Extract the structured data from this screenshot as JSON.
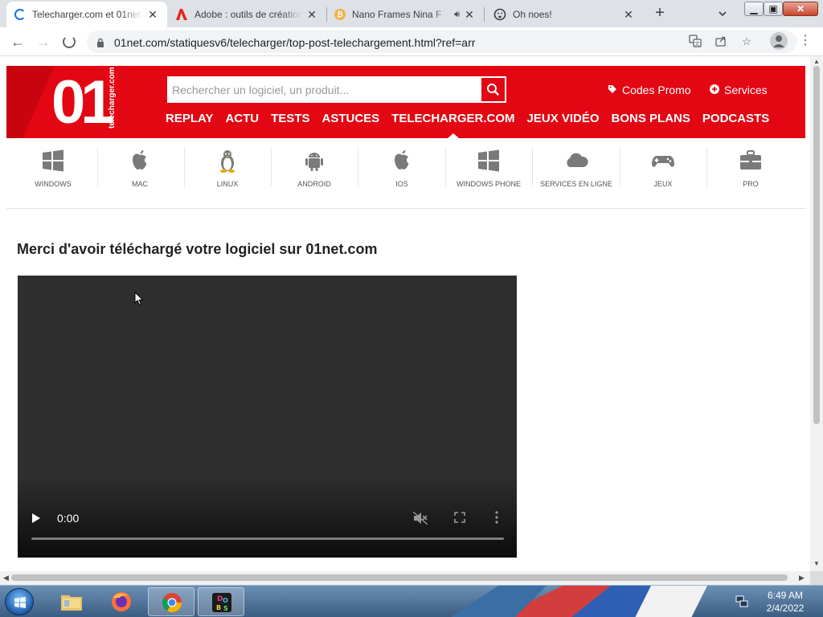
{
  "browser": {
    "tabs": [
      {
        "title": "Telecharger.com et 01net",
        "active": true,
        "favicon": "loading-spinner-icon"
      },
      {
        "title": "Adobe : outils de création",
        "active": false,
        "favicon": "adobe-icon"
      },
      {
        "title": "Nano Frames Nina F",
        "active": false,
        "favicon": "nano-icon",
        "audio": true
      },
      {
        "title": "Oh noes!",
        "active": false,
        "favicon": "oh-noes-icon"
      }
    ],
    "close_symbol": "✕",
    "new_tab_symbol": "+",
    "url": "01net.com/statiquesv6/telecharger/top-post-telechargement.html?ref=arr",
    "window_buttons": {
      "minimize": "▁",
      "maximize": "▣",
      "close": "✕"
    },
    "accent": "#1a73e8"
  },
  "site": {
    "brand_color": "#e30613",
    "logo": {
      "mark": "01",
      "sub": "telecharger.com"
    },
    "search": {
      "placeholder": "Rechercher un logiciel, un produit..."
    },
    "header_links": [
      {
        "label": "Codes Promo",
        "icon": "tag-icon"
      },
      {
        "label": "Services",
        "icon": "plus-circle-icon"
      }
    ],
    "nav": [
      "REPLAY",
      "ACTU",
      "TESTS",
      "ASTUCES",
      "TELECHARGER.COM",
      "JEUX VIDÉO",
      "BONS PLANS",
      "PODCASTS"
    ],
    "active_nav": "TELECHARGER.COM",
    "platforms": [
      {
        "label": "WINDOWS",
        "icon": "windows-icon"
      },
      {
        "label": "MAC",
        "icon": "apple-icon"
      },
      {
        "label": "LINUX",
        "icon": "linux-icon"
      },
      {
        "label": "ANDROID",
        "icon": "android-icon"
      },
      {
        "label": "IOS",
        "icon": "apple-icon"
      },
      {
        "label": "WINDOWS PHONE",
        "icon": "windows-icon"
      },
      {
        "label": "SERVICES EN LIGNE",
        "icon": "cloud-icon"
      },
      {
        "label": "JEUX",
        "icon": "gamepad-icon"
      },
      {
        "label": "PRO",
        "icon": "briefcase-icon"
      }
    ],
    "heading": "Merci d'avoir téléchargé votre logiciel sur 01net.com",
    "video": {
      "time": "0:00",
      "muted": true
    }
  },
  "taskbar": {
    "apps": [
      {
        "name": "file-explorer-icon",
        "active": false
      },
      {
        "name": "firefox-icon",
        "active": false
      },
      {
        "name": "chrome-icon",
        "active": true
      },
      {
        "name": "dosbox-icon",
        "active": true
      }
    ],
    "time": "6:49 AM",
    "date": "2/4/2022"
  }
}
